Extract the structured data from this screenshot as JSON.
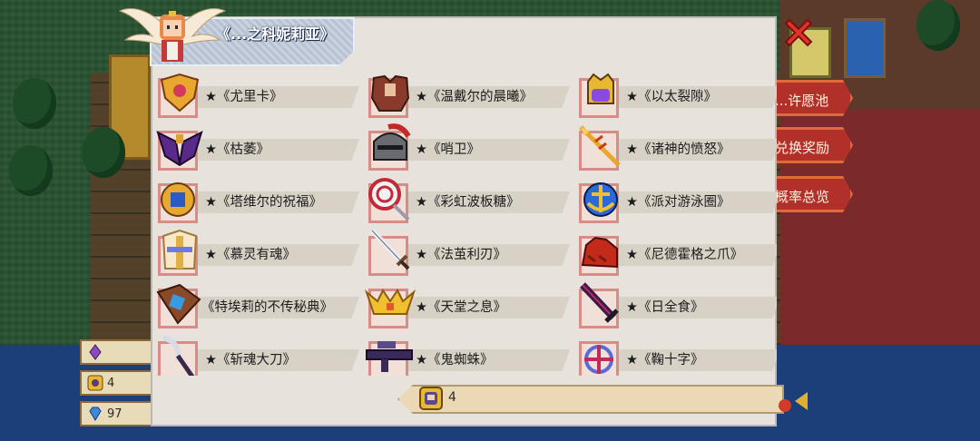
{
  "character_name": "《...之科妮莉亚》",
  "side_menu": [
    "...许愿池",
    "兑换奖励",
    "概率总览"
  ],
  "currencies": [
    {
      "icon": "purple-crystal-icon",
      "value": ""
    },
    {
      "icon": "hero-token-icon",
      "value": "4"
    },
    {
      "icon": "blue-gem-icon",
      "value": "97"
    }
  ],
  "items": [
    {
      "label": "★《尤里卡》",
      "icon": "gold-crest-icon"
    },
    {
      "label": "★《温戴尔的晨曦》",
      "icon": "armor-icon"
    },
    {
      "label": "★《以太裂隙》",
      "icon": "gem-crown-icon"
    },
    {
      "label": "★《枯萎》",
      "icon": "dark-wings-icon"
    },
    {
      "label": "★《哨卫》",
      "icon": "helmet-icon"
    },
    {
      "label": "★《诸神的愤怒》",
      "icon": "golden-spear-icon"
    },
    {
      "label": "★《塔维尔的祝福》",
      "icon": "gold-ring-icon"
    },
    {
      "label": "★《彩虹波板糖》",
      "icon": "lollipop-icon"
    },
    {
      "label": "★《派对游泳圈》",
      "icon": "anchor-icon"
    },
    {
      "label": "★《慕灵有魂》",
      "icon": "holy-robe-icon"
    },
    {
      "label": "★《法茧利刃》",
      "icon": "sword-icon"
    },
    {
      "label": "★《尼德霍格之爪》",
      "icon": "red-claw-icon"
    },
    {
      "label": "《特埃莉的不传秘典》",
      "icon": "spellbook-icon"
    },
    {
      "label": "★《天堂之息》",
      "icon": "golden-wings-icon"
    },
    {
      "label": "★《日全食》",
      "icon": "dark-sword-icon"
    },
    {
      "label": "★《斩魂大刀》",
      "icon": "scythe-icon"
    },
    {
      "label": "★《鬼蜘蛛》",
      "icon": "gun-icon"
    },
    {
      "label": "★《鞠十字》",
      "icon": "cross-emblem-icon"
    }
  ],
  "bottom_counter": {
    "value": "4",
    "icon": "hero-token-icon"
  }
}
